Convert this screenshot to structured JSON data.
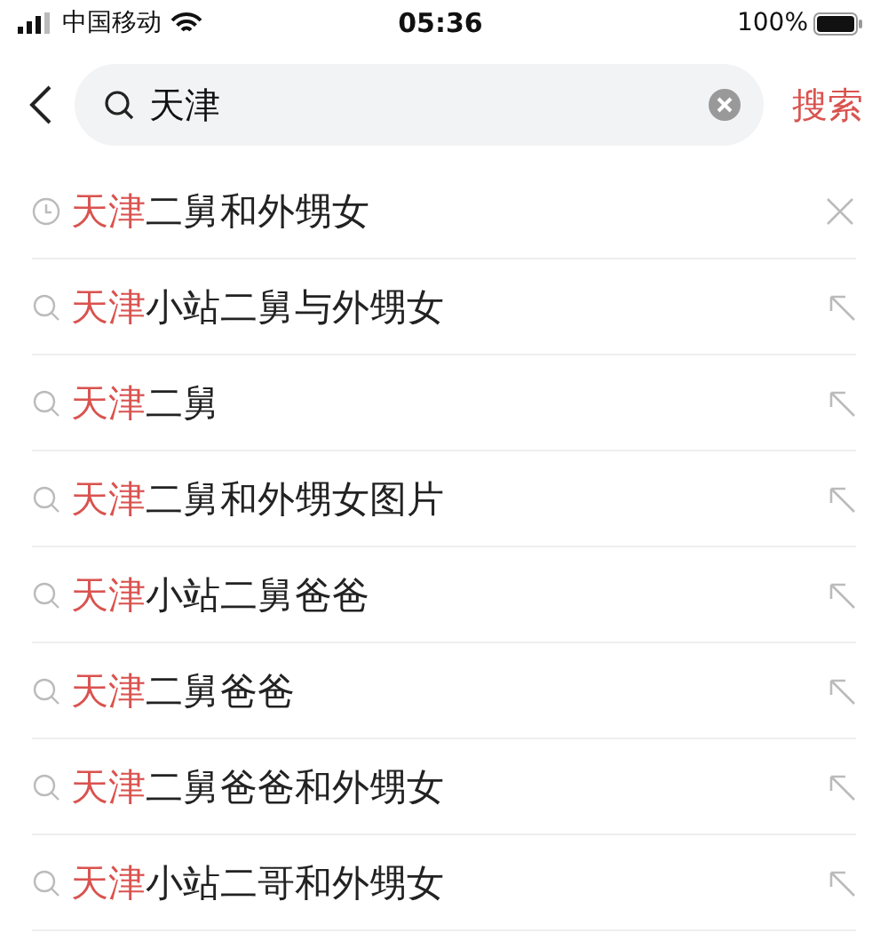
{
  "status_bar": {
    "carrier": "中国移动",
    "time": "05:36",
    "battery": "100%"
  },
  "search": {
    "value": "天津",
    "button": "搜索"
  },
  "suggestions": [
    {
      "kind": "history",
      "highlight": "天津",
      "rest": "二舅和外甥女"
    },
    {
      "kind": "suggestion",
      "highlight": "天津",
      "rest": "小站二舅与外甥女"
    },
    {
      "kind": "suggestion",
      "highlight": "天津",
      "rest": "二舅"
    },
    {
      "kind": "suggestion",
      "highlight": "天津",
      "rest": "二舅和外甥女图片"
    },
    {
      "kind": "suggestion",
      "highlight": "天津",
      "rest": "小站二舅爸爸"
    },
    {
      "kind": "suggestion",
      "highlight": "天津",
      "rest": "二舅爸爸"
    },
    {
      "kind": "suggestion",
      "highlight": "天津",
      "rest": "二舅爸爸和外甥女"
    },
    {
      "kind": "suggestion",
      "highlight": "天津",
      "rest": "小站二哥和外甥女"
    }
  ]
}
